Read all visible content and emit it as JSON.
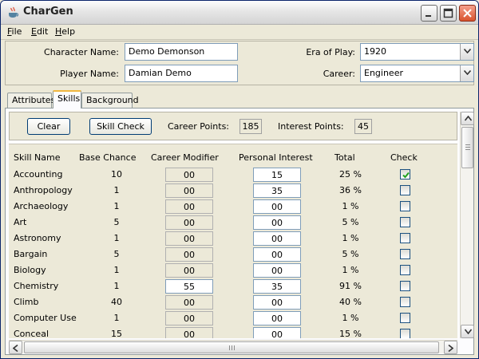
{
  "window": {
    "title": "CharGen",
    "icon": "java-cup-icon"
  },
  "menu": [
    {
      "label": "File"
    },
    {
      "label": "Edit"
    },
    {
      "label": "Help"
    }
  ],
  "form": {
    "character_name_label": "Character Name:",
    "character_name_value": "Demo Demonson",
    "player_name_label": "Player Name:",
    "player_name_value": "Damian Demo",
    "era_label": "Era of Play:",
    "era_value": "1920",
    "career_label": "Career:",
    "career_value": "Engineer"
  },
  "tabs": [
    {
      "label": "Attributes",
      "active": false
    },
    {
      "label": "Skills",
      "active": true
    },
    {
      "label": "Background",
      "active": false
    }
  ],
  "toolbar": {
    "clear_label": "Clear",
    "skill_check_label": "Skill Check",
    "career_points_label": "Career Points:",
    "career_points_value": "185",
    "interest_points_label": "Interest Points:",
    "interest_points_value": "45"
  },
  "table": {
    "headers": {
      "name": "Skill Name",
      "base": "Base Chance",
      "career": "Career Modifier",
      "interest": "Personal Interest",
      "total": "Total",
      "check": "Check"
    },
    "rows": [
      {
        "name": "Accounting",
        "base": "10",
        "career": "00",
        "interest": "15",
        "total": "25 %",
        "checked": true
      },
      {
        "name": "Anthropology",
        "base": "1",
        "career": "00",
        "interest": "35",
        "total": "36 %",
        "checked": false
      },
      {
        "name": "Archaeology",
        "base": "1",
        "career": "00",
        "interest": "00",
        "total": "1 %",
        "checked": false
      },
      {
        "name": "Art",
        "base": "5",
        "career": "00",
        "interest": "00",
        "total": "5 %",
        "checked": false
      },
      {
        "name": "Astronomy",
        "base": "1",
        "career": "00",
        "interest": "00",
        "total": "1 %",
        "checked": false
      },
      {
        "name": "Bargain",
        "base": "5",
        "career": "00",
        "interest": "00",
        "total": "5 %",
        "checked": false
      },
      {
        "name": "Biology",
        "base": "1",
        "career": "00",
        "interest": "00",
        "total": "1 %",
        "checked": false
      },
      {
        "name": "Chemistry",
        "base": "1",
        "career": "55",
        "interest": "35",
        "total": "91 %",
        "checked": false
      },
      {
        "name": "Climb",
        "base": "40",
        "career": "00",
        "interest": "00",
        "total": "40 %",
        "checked": false
      },
      {
        "name": "Computer Use",
        "base": "1",
        "career": "00",
        "interest": "00",
        "total": "1 %",
        "checked": false
      },
      {
        "name": "Conceal",
        "base": "15",
        "career": "00",
        "interest": "00",
        "total": "15 %",
        "checked": false
      }
    ]
  },
  "colors": {
    "window_bg": "#ece9d8",
    "active_tab_accent": "#f1b740",
    "field_border": "#7f9db9",
    "close_button": "#d9532e"
  }
}
